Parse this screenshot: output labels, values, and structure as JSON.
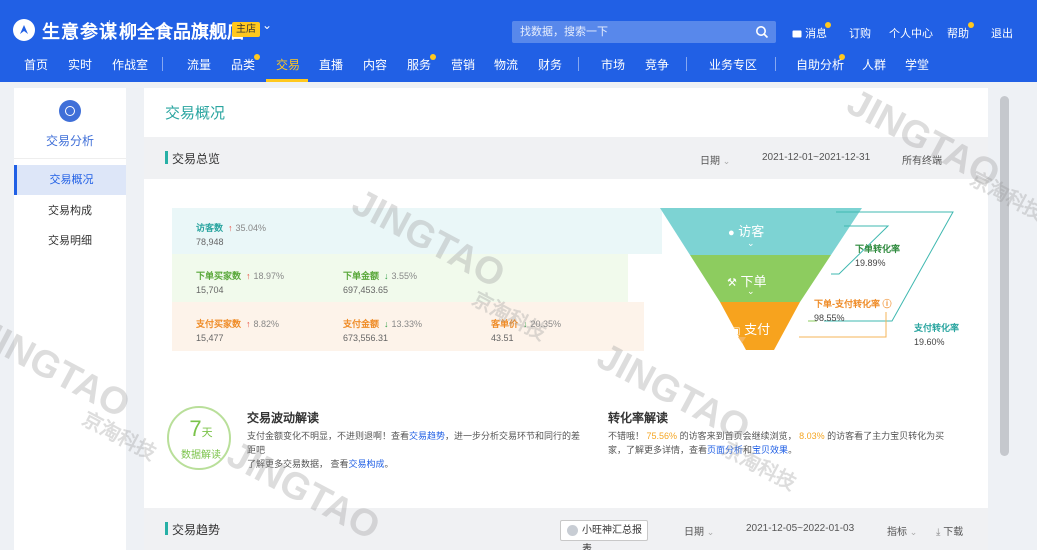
{
  "header": {
    "brand": "生意参谋",
    "store_name": "柳全食品旗舰店",
    "store_badge": "主店",
    "search_placeholder": "找数据，搜索一下",
    "top_links": {
      "messages": "消息",
      "subscribe": "订购",
      "profile": "个人中心",
      "help": "帮助",
      "logout": "退出"
    },
    "nav": [
      "首页",
      "实时",
      "作战室",
      "流量",
      "品类",
      "交易",
      "直播",
      "内容",
      "服务",
      "营销",
      "物流",
      "财务",
      "市场",
      "竞争",
      "业务专区",
      "自助分析",
      "人群",
      "学堂"
    ],
    "active_nav": "交易",
    "accent_color": "#ffc81e",
    "brand_color": "#2160e5"
  },
  "sidebar": {
    "title": "交易分析",
    "items": [
      "交易概况",
      "交易构成",
      "交易明细"
    ],
    "active": "交易概况"
  },
  "main": {
    "page_title": "交易概况",
    "overview": {
      "title": "交易总览",
      "date_label": "日期",
      "date_range": "2021-12-01~2021-12-31",
      "terminal": "所有终端"
    },
    "metrics": {
      "visitors": {
        "label": "访客数",
        "change": "35.04%",
        "direction": "up",
        "value": "78,948"
      },
      "order_buyers": {
        "label": "下单买家数",
        "change": "18.97%",
        "direction": "up",
        "value": "15,704"
      },
      "order_amount": {
        "label": "下单金额",
        "change": "3.55%",
        "direction": "down",
        "value": "697,453.65"
      },
      "pay_buyers": {
        "label": "支付买家数",
        "change": "8.82%",
        "direction": "up",
        "value": "15,477"
      },
      "pay_amount": {
        "label": "支付金额",
        "change": "13.33%",
        "direction": "down",
        "value": "673,556.31"
      },
      "unit_price": {
        "label": "客单价",
        "change": "20.35%",
        "direction": "down",
        "value": "43.51"
      }
    },
    "funnel": {
      "visit": "访客",
      "order": "下单",
      "pay": "支付",
      "order_rate_label": "下单转化率",
      "order_rate": "19.89%",
      "order_pay_rate_label": "下单-支付转化率",
      "order_pay_rate": "98.55%",
      "pay_rate_label": "支付转化率",
      "pay_rate": "19.60%"
    },
    "insight": {
      "badge_number": "7",
      "badge_unit": "天",
      "badge_sub": "数据解读",
      "wave_title": "交易波动解读",
      "wave_text_1": "支付金额变化不明显，不进则退啊！查看",
      "wave_link_1": "交易趋势",
      "wave_text_2": "，进一步分析交易环节和同行的差距吧",
      "wave_text_3": "了解更多交易数据， 查看",
      "wave_link_2": "交易构成",
      "wave_text_4": "。",
      "conv_title": "转化率解读",
      "conv_text_1": "不错哦！",
      "conv_pct_1": "75.56%",
      "conv_text_2": "的访客来到首页会继续浏览，",
      "conv_pct_2": "8.03%",
      "conv_text_3": "的访客看了主力宝贝转化为买",
      "conv_text_4": "家，了解更多详情，查看",
      "conv_link_1": "页面分析",
      "conv_text_5": "和",
      "conv_link_2": "宝贝效果",
      "conv_text_6": "。"
    },
    "trend": {
      "title": "交易趋势",
      "report_button": "小旺神汇总报表",
      "date_label": "日期",
      "date_range": "2021-12-05~2022-01-03",
      "indicator": "指标",
      "download": "下载"
    }
  },
  "watermark": {
    "text": "JINGTAO",
    "sub": "京淘科技"
  }
}
